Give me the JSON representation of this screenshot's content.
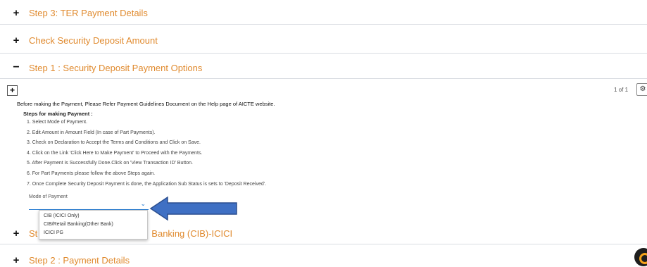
{
  "sections": {
    "step3": {
      "toggle": "+",
      "title": "Step 3: TER Payment Details"
    },
    "security_check": {
      "toggle": "+",
      "title": "Check Security Deposit Amount"
    },
    "step1": {
      "toggle": "−",
      "title": "Step 1 : Security Deposit Payment Options"
    },
    "hidden_cib": {
      "toggle": "+",
      "prefix": "St",
      "suffix": "Banking (CIB)-ICICI"
    },
    "step2": {
      "toggle": "+",
      "title": "Step 2 : Payment Details"
    }
  },
  "toolbar": {
    "expand": "+",
    "pager": "1 of 1",
    "gear": "⚙"
  },
  "intro_text": "Before making the Payment, Please Refer Payment Guidelines Document on the Help page of AICTE website.",
  "steps_title": "Steps for making Payment :",
  "steps": [
    "1. Select Mode of Payment.",
    "2. Edit Amount in Amount Field (In case of Part Payments).",
    "3. Check on Declaration to Accept the Terms and Conditions and Click on Save.",
    "4. Click on the Link 'Click Here to Make Payment' to Proceed with the Payments.",
    "5. After Payment is Successfully Done.Click on 'View Transaction ID' Button.",
    "6. For Part Payments please follow the above Steps again.",
    "7. Once Complete Security Deposit Payment is done, the Application Sub Status is sets to 'Deposit Received'."
  ],
  "mode_of_payment": {
    "label": "Mode of Payment",
    "value": "",
    "options": [
      "CIB (ICICI Only)",
      "CIB/Retail Banking(Other Bank)",
      "ICICI PG"
    ]
  },
  "colors": {
    "section_title": "#e08a2e",
    "arrow": "#3f70c4",
    "select_underline": "#1f78d1"
  }
}
